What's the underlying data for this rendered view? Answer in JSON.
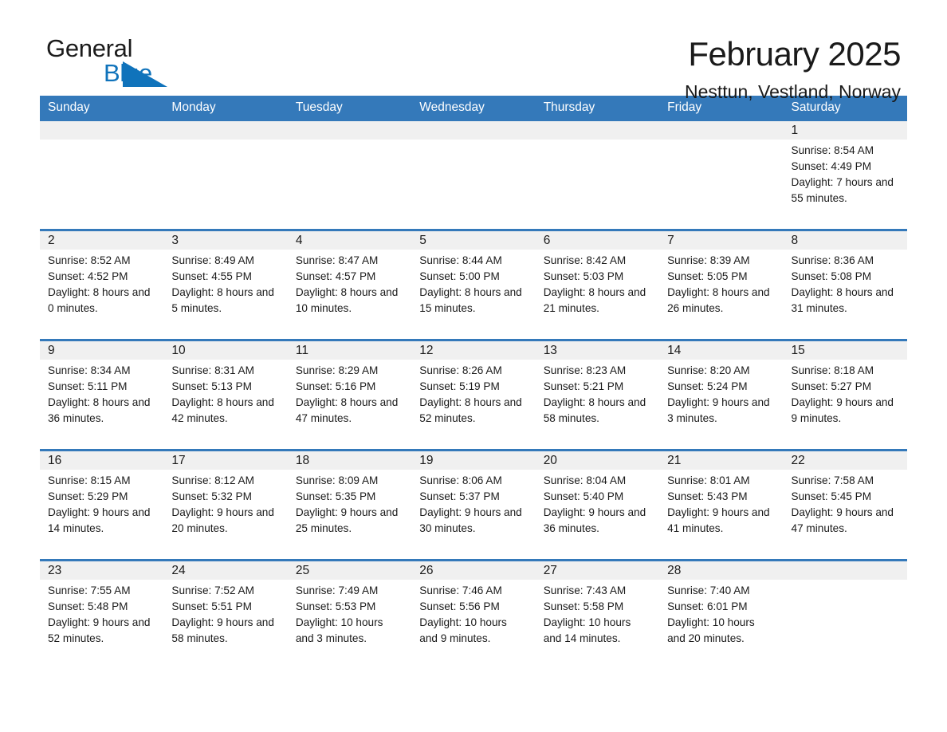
{
  "brand": {
    "name_part1": "General",
    "name_part2": "Blue",
    "accent_color": "#1073bb"
  },
  "header": {
    "title": "February 2025",
    "subtitle": "Nesttun, Vestland, Norway"
  },
  "theme": {
    "header_blue": "#3479ba",
    "day_strip_gray": "#f0f0f0"
  },
  "weekday_headers": [
    "Sunday",
    "Monday",
    "Tuesday",
    "Wednesday",
    "Thursday",
    "Friday",
    "Saturday"
  ],
  "labels": {
    "sunrise_prefix": "Sunrise:",
    "sunset_prefix": "Sunset:",
    "daylight_prefix": "Daylight:"
  },
  "weeks": [
    {
      "days": [
        {
          "day": "",
          "sunrise": "",
          "sunset": "",
          "daylight": "",
          "empty": true
        },
        {
          "day": "",
          "sunrise": "",
          "sunset": "",
          "daylight": "",
          "empty": true
        },
        {
          "day": "",
          "sunrise": "",
          "sunset": "",
          "daylight": "",
          "empty": true
        },
        {
          "day": "",
          "sunrise": "",
          "sunset": "",
          "daylight": "",
          "empty": true
        },
        {
          "day": "",
          "sunrise": "",
          "sunset": "",
          "daylight": "",
          "empty": true
        },
        {
          "day": "",
          "sunrise": "",
          "sunset": "",
          "daylight": "",
          "empty": true
        },
        {
          "day": "1",
          "sunrise": "Sunrise: 8:54 AM",
          "sunset": "Sunset: 4:49 PM",
          "daylight": "Daylight: 7 hours and 55 minutes.",
          "empty": false
        }
      ]
    },
    {
      "days": [
        {
          "day": "2",
          "sunrise": "Sunrise: 8:52 AM",
          "sunset": "Sunset: 4:52 PM",
          "daylight": "Daylight: 8 hours and 0 minutes.",
          "empty": false
        },
        {
          "day": "3",
          "sunrise": "Sunrise: 8:49 AM",
          "sunset": "Sunset: 4:55 PM",
          "daylight": "Daylight: 8 hours and 5 minutes.",
          "empty": false
        },
        {
          "day": "4",
          "sunrise": "Sunrise: 8:47 AM",
          "sunset": "Sunset: 4:57 PM",
          "daylight": "Daylight: 8 hours and 10 minutes.",
          "empty": false
        },
        {
          "day": "5",
          "sunrise": "Sunrise: 8:44 AM",
          "sunset": "Sunset: 5:00 PM",
          "daylight": "Daylight: 8 hours and 15 minutes.",
          "empty": false
        },
        {
          "day": "6",
          "sunrise": "Sunrise: 8:42 AM",
          "sunset": "Sunset: 5:03 PM",
          "daylight": "Daylight: 8 hours and 21 minutes.",
          "empty": false
        },
        {
          "day": "7",
          "sunrise": "Sunrise: 8:39 AM",
          "sunset": "Sunset: 5:05 PM",
          "daylight": "Daylight: 8 hours and 26 minutes.",
          "empty": false
        },
        {
          "day": "8",
          "sunrise": "Sunrise: 8:36 AM",
          "sunset": "Sunset: 5:08 PM",
          "daylight": "Daylight: 8 hours and 31 minutes.",
          "empty": false
        }
      ]
    },
    {
      "days": [
        {
          "day": "9",
          "sunrise": "Sunrise: 8:34 AM",
          "sunset": "Sunset: 5:11 PM",
          "daylight": "Daylight: 8 hours and 36 minutes.",
          "empty": false
        },
        {
          "day": "10",
          "sunrise": "Sunrise: 8:31 AM",
          "sunset": "Sunset: 5:13 PM",
          "daylight": "Daylight: 8 hours and 42 minutes.",
          "empty": false
        },
        {
          "day": "11",
          "sunrise": "Sunrise: 8:29 AM",
          "sunset": "Sunset: 5:16 PM",
          "daylight": "Daylight: 8 hours and 47 minutes.",
          "empty": false
        },
        {
          "day": "12",
          "sunrise": "Sunrise: 8:26 AM",
          "sunset": "Sunset: 5:19 PM",
          "daylight": "Daylight: 8 hours and 52 minutes.",
          "empty": false
        },
        {
          "day": "13",
          "sunrise": "Sunrise: 8:23 AM",
          "sunset": "Sunset: 5:21 PM",
          "daylight": "Daylight: 8 hours and 58 minutes.",
          "empty": false
        },
        {
          "day": "14",
          "sunrise": "Sunrise: 8:20 AM",
          "sunset": "Sunset: 5:24 PM",
          "daylight": "Daylight: 9 hours and 3 minutes.",
          "empty": false
        },
        {
          "day": "15",
          "sunrise": "Sunrise: 8:18 AM",
          "sunset": "Sunset: 5:27 PM",
          "daylight": "Daylight: 9 hours and 9 minutes.",
          "empty": false
        }
      ]
    },
    {
      "days": [
        {
          "day": "16",
          "sunrise": "Sunrise: 8:15 AM",
          "sunset": "Sunset: 5:29 PM",
          "daylight": "Daylight: 9 hours and 14 minutes.",
          "empty": false
        },
        {
          "day": "17",
          "sunrise": "Sunrise: 8:12 AM",
          "sunset": "Sunset: 5:32 PM",
          "daylight": "Daylight: 9 hours and 20 minutes.",
          "empty": false
        },
        {
          "day": "18",
          "sunrise": "Sunrise: 8:09 AM",
          "sunset": "Sunset: 5:35 PM",
          "daylight": "Daylight: 9 hours and 25 minutes.",
          "empty": false
        },
        {
          "day": "19",
          "sunrise": "Sunrise: 8:06 AM",
          "sunset": "Sunset: 5:37 PM",
          "daylight": "Daylight: 9 hours and 30 minutes.",
          "empty": false
        },
        {
          "day": "20",
          "sunrise": "Sunrise: 8:04 AM",
          "sunset": "Sunset: 5:40 PM",
          "daylight": "Daylight: 9 hours and 36 minutes.",
          "empty": false
        },
        {
          "day": "21",
          "sunrise": "Sunrise: 8:01 AM",
          "sunset": "Sunset: 5:43 PM",
          "daylight": "Daylight: 9 hours and 41 minutes.",
          "empty": false
        },
        {
          "day": "22",
          "sunrise": "Sunrise: 7:58 AM",
          "sunset": "Sunset: 5:45 PM",
          "daylight": "Daylight: 9 hours and 47 minutes.",
          "empty": false
        }
      ]
    },
    {
      "days": [
        {
          "day": "23",
          "sunrise": "Sunrise: 7:55 AM",
          "sunset": "Sunset: 5:48 PM",
          "daylight": "Daylight: 9 hours and 52 minutes.",
          "empty": false
        },
        {
          "day": "24",
          "sunrise": "Sunrise: 7:52 AM",
          "sunset": "Sunset: 5:51 PM",
          "daylight": "Daylight: 9 hours and 58 minutes.",
          "empty": false
        },
        {
          "day": "25",
          "sunrise": "Sunrise: 7:49 AM",
          "sunset": "Sunset: 5:53 PM",
          "daylight": "Daylight: 10 hours and 3 minutes.",
          "empty": false
        },
        {
          "day": "26",
          "sunrise": "Sunrise: 7:46 AM",
          "sunset": "Sunset: 5:56 PM",
          "daylight": "Daylight: 10 hours and 9 minutes.",
          "empty": false
        },
        {
          "day": "27",
          "sunrise": "Sunrise: 7:43 AM",
          "sunset": "Sunset: 5:58 PM",
          "daylight": "Daylight: 10 hours and 14 minutes.",
          "empty": false
        },
        {
          "day": "28",
          "sunrise": "Sunrise: 7:40 AM",
          "sunset": "Sunset: 6:01 PM",
          "daylight": "Daylight: 10 hours and 20 minutes.",
          "empty": false
        },
        {
          "day": "",
          "sunrise": "",
          "sunset": "",
          "daylight": "",
          "empty": true
        }
      ]
    }
  ]
}
